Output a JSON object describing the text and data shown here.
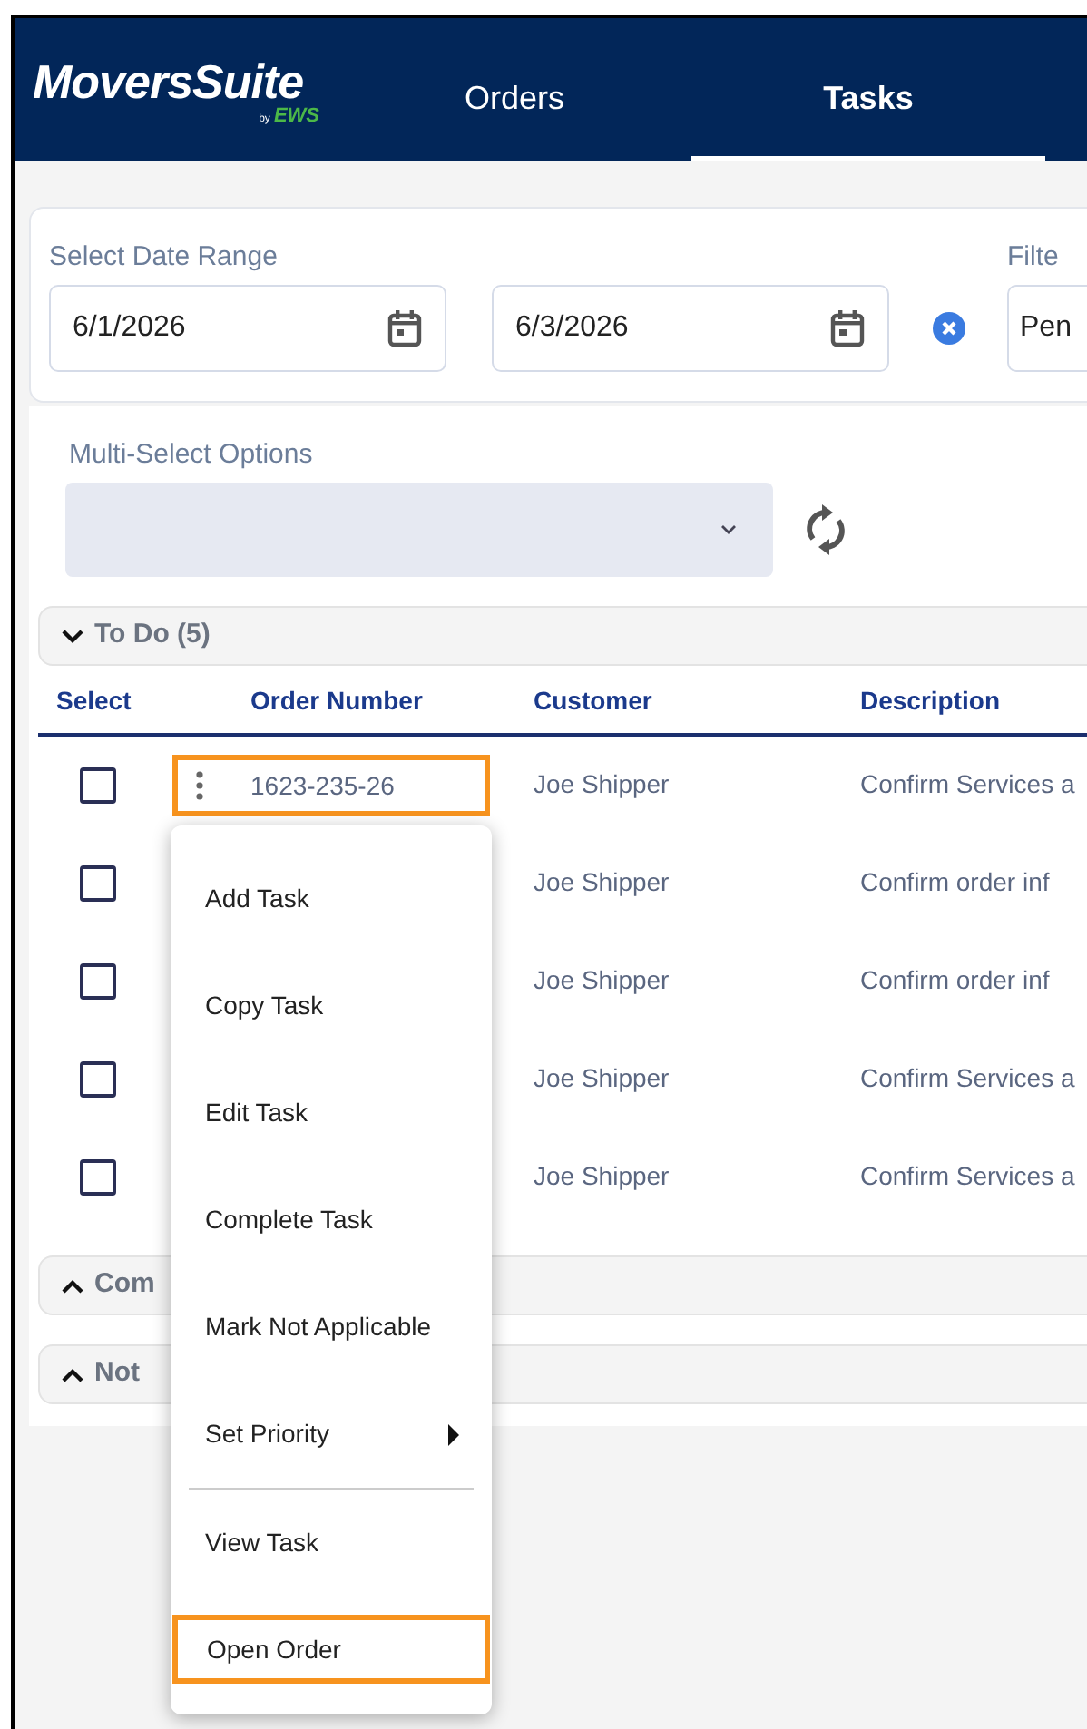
{
  "app": {
    "logo": "MoversSuite",
    "logo_by": "by",
    "logo_brand": "EWS"
  },
  "nav_tabs": [
    {
      "label": "Orders",
      "selected": false
    },
    {
      "label": "Tasks",
      "selected": true
    }
  ],
  "filters": {
    "date_range_label": "Select Date Range",
    "start_date": "6/1/2026",
    "end_date": "6/3/2026",
    "filter_label": "Filte",
    "filter_value": "Pen"
  },
  "multi_select": {
    "label": "Multi-Select Options"
  },
  "table": {
    "columns": [
      "Select",
      "Order Number",
      "Customer",
      "Description"
    ]
  },
  "groups": [
    {
      "label": "To Do (5)",
      "expanded": true,
      "rows": [
        {
          "checked": false,
          "order_number": "1623-235-26",
          "highlighted": true,
          "customer": "Joe Shipper",
          "description": "Confirm Services a"
        },
        {
          "checked": false,
          "customer": "Joe Shipper",
          "description": "Confirm order inf"
        },
        {
          "checked": false,
          "customer": "Joe Shipper",
          "description": "Confirm order inf"
        },
        {
          "checked": false,
          "customer": "Joe Shipper",
          "description": "Confirm Services a"
        },
        {
          "checked": false,
          "customer": "Joe Shipper",
          "description": "Confirm Services a"
        }
      ]
    },
    {
      "label": "Com",
      "expanded": false
    },
    {
      "label": "Not",
      "expanded": false
    }
  ],
  "context_menu": {
    "items": [
      {
        "kind": "item",
        "label": "Add Task",
        "highlighted": false
      },
      {
        "kind": "item",
        "label": "Copy Task",
        "highlighted": false
      },
      {
        "kind": "item",
        "label": "Edit Task",
        "highlighted": false
      },
      {
        "kind": "item",
        "label": "Complete Task",
        "highlighted": false
      },
      {
        "kind": "item",
        "label": "Mark Not Applicable",
        "highlighted": false
      },
      {
        "kind": "submenu",
        "label": "Set Priority",
        "highlighted": false
      },
      {
        "kind": "divider"
      },
      {
        "kind": "item",
        "label": "View Task",
        "highlighted": false
      },
      {
        "kind": "item",
        "label": "Open Order",
        "highlighted": true
      }
    ]
  }
}
